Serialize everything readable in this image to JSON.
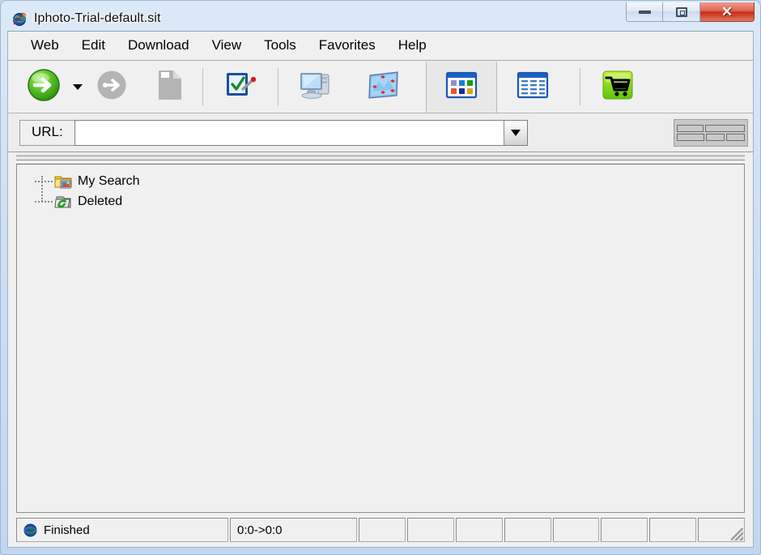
{
  "window": {
    "title": "Iphoto-Trial-default.sit",
    "app_icon": "globe-app-icon",
    "caption": {
      "minimize": "Minimize",
      "restore": "Restore",
      "close": "Close",
      "minimize_glyph": "minimize-icon",
      "restore_glyph": "restore-icon",
      "close_glyph": "✕"
    }
  },
  "menubar": {
    "items": [
      {
        "label": "Web"
      },
      {
        "label": "Edit"
      },
      {
        "label": "Download"
      },
      {
        "label": "View"
      },
      {
        "label": "Tools"
      },
      {
        "label": "Favorites"
      },
      {
        "label": "Help"
      }
    ]
  },
  "toolbar": {
    "buttons": [
      {
        "name": "go-button",
        "icon": "green-arrow-go-icon",
        "enabled": true
      },
      {
        "name": "go-dropdown",
        "icon": "chevron-down-icon",
        "enabled": true
      },
      {
        "name": "stop-button",
        "icon": "gray-arrow-disabled-icon",
        "enabled": false
      },
      {
        "name": "new-document-button",
        "icon": "document-page-icon",
        "enabled": false
      },
      {
        "name": "checklist-button",
        "icon": "checklist-edit-icon",
        "enabled": true
      },
      {
        "name": "computer-button",
        "icon": "computer-monitor-icon",
        "enabled": true
      },
      {
        "name": "image-map-button",
        "icon": "blue-image-map-icon",
        "enabled": true
      },
      {
        "name": "thumbnail-view-button",
        "icon": "thumbnail-grid-icon",
        "enabled": true,
        "pressed": true
      },
      {
        "name": "details-view-button",
        "icon": "details-list-icon",
        "enabled": true,
        "pressed": false
      },
      {
        "name": "cart-button",
        "icon": "shopping-cart-icon",
        "enabled": true
      }
    ]
  },
  "urlbar": {
    "label": "URL:",
    "value": "",
    "placeholder": "",
    "dropdown_icon": "chevron-down-icon",
    "grip_icon": "brick-wall-grip-icon"
  },
  "tree": {
    "items": [
      {
        "label": "My Search",
        "icon": "folder-search-icon"
      },
      {
        "label": "Deleted",
        "icon": "recycle-restore-icon"
      }
    ]
  },
  "statusbar": {
    "status_icon": "globe-icon",
    "status_text": "Finished",
    "progress_text": "0:0->0:0",
    "empty_panes": 8,
    "resize_grip": "resize-grip-icon"
  },
  "colors": {
    "frame": "#c2d7ef",
    "client_bg": "#f0f0f0",
    "close_red": "#c62b18",
    "go_green": "#3eaa1e",
    "cart_green": "#7ed321",
    "folder_yellow": "#f2d24b"
  }
}
